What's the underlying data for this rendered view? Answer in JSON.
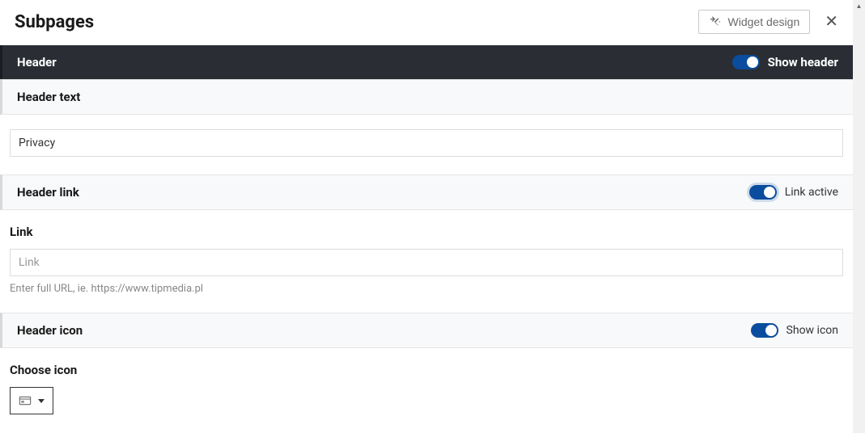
{
  "page": {
    "title": "Subpages",
    "widget_design_label": "Widget design",
    "close_label": "Close"
  },
  "sections": {
    "header": {
      "label": "Header",
      "toggle_label": "Show header",
      "toggle_on": true
    },
    "header_text": {
      "label": "Header text",
      "value": "Privacy"
    },
    "header_link": {
      "label": "Header link",
      "toggle_label": "Link active",
      "toggle_on": true
    },
    "link_field": {
      "label": "Link",
      "placeholder": "Link",
      "helper": "Enter full URL, ie. https://www.tipmedia.pl"
    },
    "header_icon": {
      "label": "Header icon",
      "toggle_label": "Show icon",
      "toggle_on": true
    },
    "choose_icon": {
      "label": "Choose icon",
      "icon_name": "card-icon"
    }
  }
}
